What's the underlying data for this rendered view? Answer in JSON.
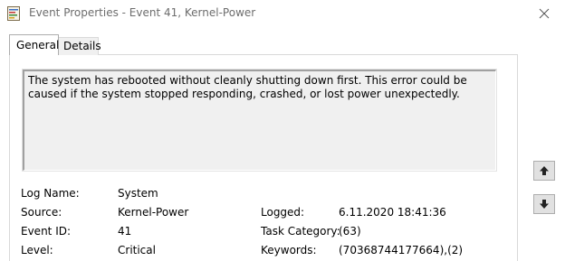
{
  "window": {
    "title": "Event Properties - Event 41, Kernel-Power"
  },
  "tabs": [
    {
      "label": "General",
      "selected": true
    },
    {
      "label": "Details",
      "selected": false
    }
  ],
  "description": "The system has rebooted without cleanly shutting down first. This error could be caused if the system stopped responding, crashed, or lost power unexpectedly.",
  "fields": {
    "log_name": {
      "label": "Log Name:",
      "value": "System"
    },
    "source": {
      "label": "Source:",
      "value": "Kernel-Power"
    },
    "logged": {
      "label": "Logged:",
      "value": "6.11.2020 18:41:36"
    },
    "event_id": {
      "label": "Event ID:",
      "value": "41"
    },
    "task_category": {
      "label": "Task Category:",
      "value": "(63)"
    },
    "level": {
      "label": "Level:",
      "value": "Critical"
    },
    "keywords": {
      "label": "Keywords:",
      "value": "(70368744177664),(2)"
    }
  },
  "icons": {
    "app": "event-viewer-icon",
    "close": "close-icon",
    "up": "arrow-up-icon",
    "down": "arrow-down-icon"
  }
}
